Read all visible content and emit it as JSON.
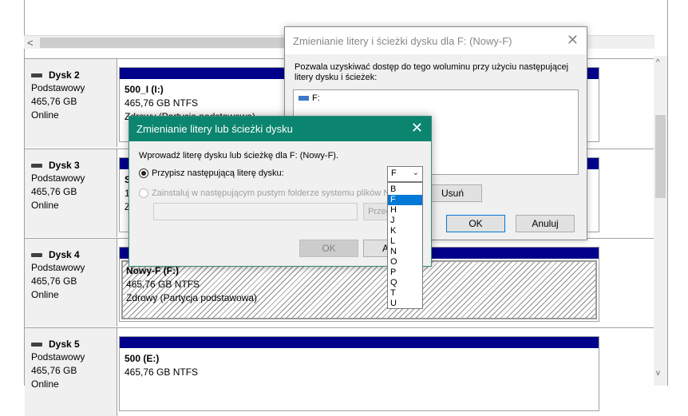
{
  "hscroll": {
    "left_arrow": "<"
  },
  "vscroll": {
    "up_arrow": "^",
    "down_arrow": "v"
  },
  "disks": [
    {
      "name": "Dysk 2",
      "type": "Podstawowy",
      "size": "465,76 GB",
      "status": "Online",
      "partition": {
        "name": "500_I  (I:)",
        "fs": "465,76 GB NTFS",
        "health": "Zdrowy (Partycja podstawowa)"
      }
    },
    {
      "name": "Dysk 3",
      "type": "Podstawowy",
      "size": "465,76 GB",
      "status": "Online",
      "partition": {
        "name": "S",
        "fs": "1",
        "health": "Z"
      }
    },
    {
      "name": "Dysk 4",
      "type": "Podstawowy",
      "size": "465,76 GB",
      "status": "Online",
      "partition": {
        "name": "Nowy-F  (F:)",
        "fs": "465,76 GB NTFS",
        "health": "Zdrowy (Partycja podstawowa)"
      }
    },
    {
      "name": "Dysk 5",
      "type": "Podstawowy",
      "size": "465,76 GB",
      "status": "Online",
      "partition": {
        "name": "500  (E:)",
        "fs": "465,76 GB NTFS",
        "health": ""
      }
    }
  ],
  "dialog_paths": {
    "title": "Zmienianie litery i ścieżki dysku dla F: (Nowy-F)",
    "close": "✕",
    "description": "Pozwala uzyskiwać dostęp do tego woluminu przy użyciu następującej litery dysku i ścieżek:",
    "list_items": [
      "F:"
    ],
    "remove_label": "Usuń",
    "ok_label": "OK",
    "cancel_label": "Anuluj"
  },
  "dialog_letter": {
    "title": "Zmienianie litery lub ścieżki dysku",
    "close": "✕",
    "prompt": "Wprowadź literę dysku lub ścieżkę dla F: (Nowy-F).",
    "option_assign": "Przypisz następującą literę dysku:",
    "option_mount": "Zainstaluj w następującym pustym folderze systemu plików NTFS:",
    "browse_label": "Przeglądaj...",
    "ok_label": "OK",
    "cancel_label": "Anuluj",
    "selected_letter": "F",
    "letter_options": [
      "B",
      "F",
      "H",
      "J",
      "K",
      "L",
      "N",
      "O",
      "P",
      "Q",
      "T",
      "U"
    ]
  }
}
